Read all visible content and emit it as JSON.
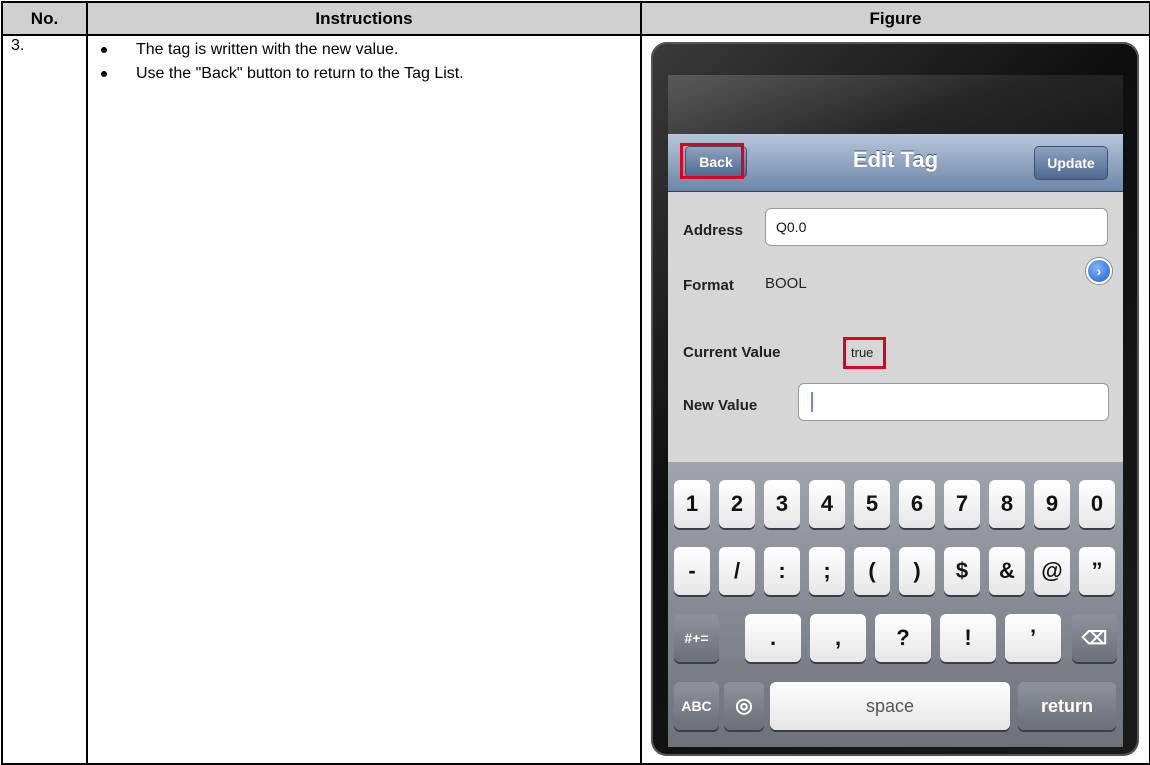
{
  "table": {
    "headers": [
      "No.",
      "Instructions",
      "Figure"
    ],
    "step_number": "3.",
    "instructions": [
      "The tag is written with the new value.",
      "Use the \"Back\" button to return to the Tag List."
    ]
  },
  "phone": {
    "nav": {
      "title": "Edit Tag",
      "back_label": "Back",
      "update_label": "Update"
    },
    "form": {
      "address_label": "Address",
      "address_value": "Q0.0",
      "format_label": "Format",
      "format_value": "BOOL",
      "current_label": "Current Value",
      "current_value": "true",
      "new_label": "New Value",
      "new_value": ""
    },
    "keyboard": {
      "row1": [
        "1",
        "2",
        "3",
        "4",
        "5",
        "6",
        "7",
        "8",
        "9",
        "0"
      ],
      "row2": [
        "-",
        "/",
        ":",
        ";",
        "(",
        ")",
        "$",
        "&",
        "@",
        "”"
      ],
      "row3_shift": "#+=",
      "row3": [
        ".",
        ",",
        "?",
        "!",
        "’"
      ],
      "abc": "ABC",
      "space": "space",
      "return": "return"
    },
    "highlight_color": "#e0001b"
  }
}
